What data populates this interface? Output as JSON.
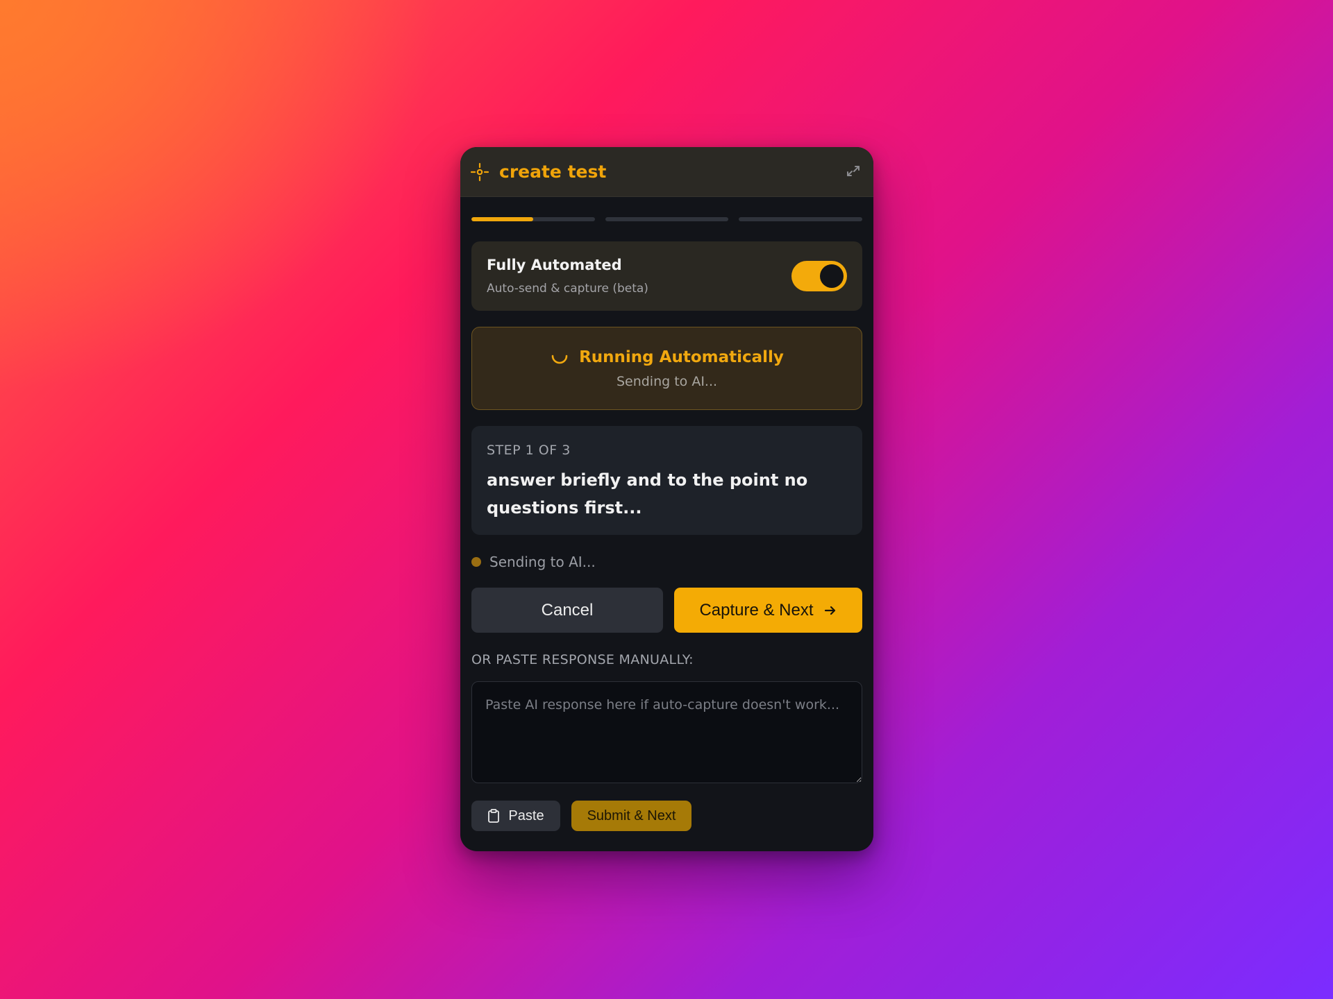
{
  "header": {
    "title": "create test",
    "logo_icon": "target-icon",
    "dock_icon": "undock-icon"
  },
  "progress": {
    "steps": 3,
    "current": 1,
    "current_fraction": 0.5
  },
  "automation": {
    "label": "Fully Automated",
    "sublabel": "Auto-send & capture (beta)",
    "enabled": true
  },
  "running": {
    "title": "Running Automatically",
    "subtitle": "Sending to AI..."
  },
  "step": {
    "label": "STEP 1 OF 3",
    "text": "answer briefly and to the point no questions first..."
  },
  "status": {
    "text": "Sending to AI..."
  },
  "actions": {
    "cancel_label": "Cancel",
    "capture_label": "Capture & Next"
  },
  "manual": {
    "label": "OR PASTE RESPONSE MANUALLY:",
    "placeholder": "Paste AI response here if auto-capture doesn't work...",
    "value": ""
  },
  "bottom": {
    "paste_label": "Paste",
    "submit_label": "Submit & Next"
  },
  "colors": {
    "accent": "#f4ab05",
    "panel": "#121419",
    "header": "#2b2924"
  }
}
